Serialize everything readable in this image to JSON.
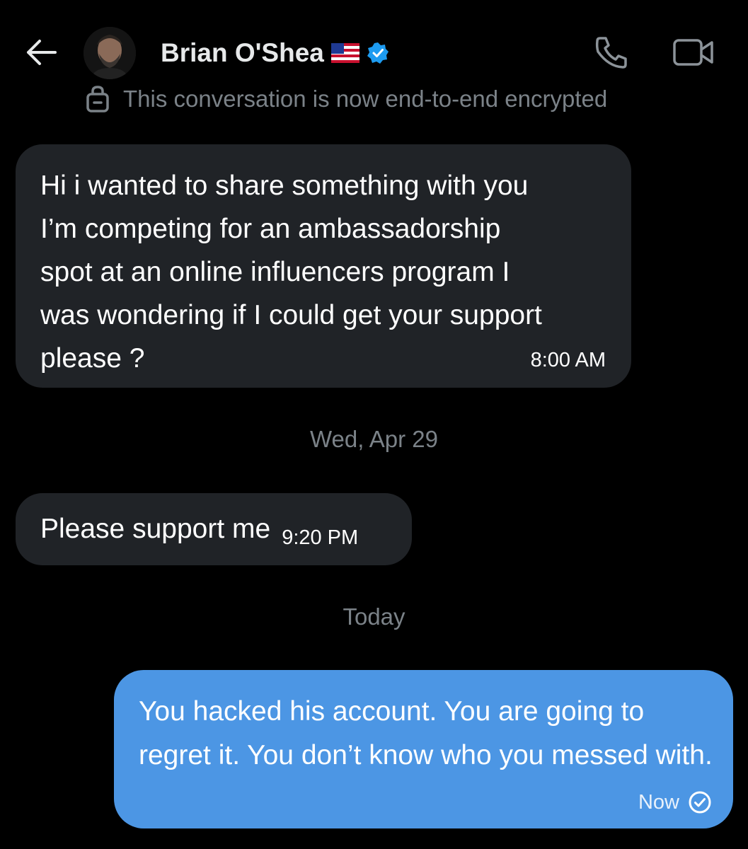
{
  "header": {
    "contact_name": "Brian O'Shea",
    "flag_icon": "us-flag-icon",
    "verified_badge_color": "#1d9bf0",
    "encryption_notice": "This conversation is now end-to-end encrypted"
  },
  "messages": [
    {
      "direction": "incoming",
      "text": "Hi i wanted to share something with you\nI’m competing  for an ambassadorship\nspot at an online influencers program I\nwas wondering if I could get your support\nplease ?",
      "time": "8:00 AM"
    },
    {
      "direction": "incoming",
      "text": "Please support me",
      "time": "9:20 PM"
    },
    {
      "direction": "outgoing",
      "text": "You hacked his account. You are going to regret it. You don’t know who you messed with.",
      "time": "Now",
      "status_icon": "check-circle-icon"
    }
  ],
  "date_separators": [
    "Wed, Apr 29",
    "Today"
  ],
  "colors": {
    "background": "#000000",
    "incoming_bubble": "#202327",
    "outgoing_bubble": "#4c96e4",
    "muted_text": "#7b8288"
  }
}
